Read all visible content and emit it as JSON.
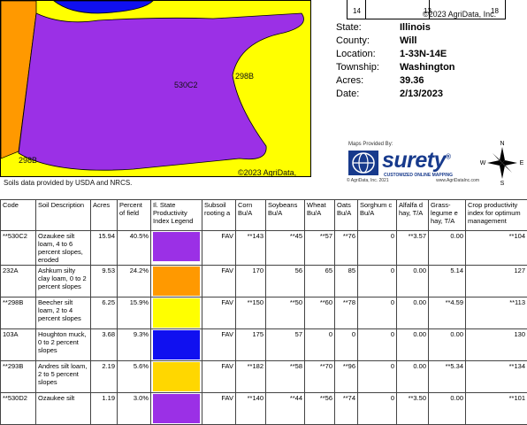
{
  "map": {
    "unit_labels": [
      "530C2",
      "298B",
      "298B"
    ],
    "copyright": "©2023 AgriData, Inc.",
    "source_note": "Soils data provided by USDA and NRCS."
  },
  "section_grid": {
    "numbers": [
      "14",
      "13",
      "18"
    ],
    "copyright": "©2023 AgriData, Inc."
  },
  "info": {
    "rows": [
      {
        "label": "State:",
        "value": "Illinois"
      },
      {
        "label": "County:",
        "value": "Will"
      },
      {
        "label": "Location:",
        "value": "1-33N-14E"
      },
      {
        "label": "Township:",
        "value": "Washington"
      },
      {
        "label": "Acres:",
        "value": "39.36"
      },
      {
        "label": "Date:",
        "value": "2/13/2023"
      }
    ]
  },
  "logo": {
    "maps_provided_by": "Maps Provided By:",
    "word": "surety",
    "registered": "®",
    "tagline": "CUSTOMIZED ONLINE MAPPING",
    "footer_left": "© AgriData, Inc. 2021",
    "footer_right": "www.AgriDataInc.com"
  },
  "compass": {
    "n": "N",
    "s": "S",
    "e": "E",
    "w": "W"
  },
  "colors": {
    "purple": "#9b30e6",
    "orange": "#ff9900",
    "yellow": "#ffff00",
    "blue": "#1010f0",
    "gold": "#ffd700",
    "surety_blue": "#173a8c"
  },
  "table": {
    "headers": [
      "Code",
      "Soil Description",
      "Acres",
      "Percent of field",
      "Il. State Productivity Index Legend",
      "Subsoil rooting a",
      "Corn Bu/A",
      "Soybeans Bu/A",
      "Wheat Bu/A",
      "Oats Bu/A",
      "Sorghum c Bu/A",
      "Alfalfa d hay, T/A",
      "Grass-legume e hay, T/A",
      "Crop productivity index for optimum management"
    ],
    "rows": [
      {
        "code": "**530C2",
        "desc": "Ozaukee silt loam, 4 to 6 percent slopes, eroded",
        "acres": "15.94",
        "pct": "40.5%",
        "color": "#9b30e6",
        "subsoil": "FAV",
        "corn": "**143",
        "soy": "**45",
        "wheat": "**57",
        "oats": "**76",
        "sorghum": "0",
        "alfalfa": "**3.57",
        "grass": "0.00",
        "cpi": "**104"
      },
      {
        "code": "232A",
        "desc": "Ashkum silty clay loam, 0 to 2 percent slopes",
        "acres": "9.53",
        "pct": "24.2%",
        "color": "#ff9900",
        "subsoil": "FAV",
        "corn": "170",
        "soy": "56",
        "wheat": "65",
        "oats": "85",
        "sorghum": "0",
        "alfalfa": "0.00",
        "grass": "5.14",
        "cpi": "127"
      },
      {
        "code": "**298B",
        "desc": "Beecher silt loam, 2 to 4 percent slopes",
        "acres": "6.25",
        "pct": "15.9%",
        "color": "#ffff00",
        "subsoil": "FAV",
        "corn": "**150",
        "soy": "**50",
        "wheat": "**60",
        "oats": "**78",
        "sorghum": "0",
        "alfalfa": "0.00",
        "grass": "**4.59",
        "cpi": "**113"
      },
      {
        "code": "103A",
        "desc": "Houghton muck, 0 to 2 percent slopes",
        "acres": "3.68",
        "pct": "9.3%",
        "color": "#1010f0",
        "subsoil": "FAV",
        "corn": "175",
        "soy": "57",
        "wheat": "0",
        "oats": "0",
        "sorghum": "0",
        "alfalfa": "0.00",
        "grass": "0.00",
        "cpi": "130"
      },
      {
        "code": "**293B",
        "desc": "Andres silt loam, 2 to 5 percent slopes",
        "acres": "2.19",
        "pct": "5.6%",
        "color": "#ffd700",
        "subsoil": "FAV",
        "corn": "**182",
        "soy": "**58",
        "wheat": "**70",
        "oats": "**96",
        "sorghum": "0",
        "alfalfa": "0.00",
        "grass": "**5.34",
        "cpi": "**134"
      },
      {
        "code": "**530D2",
        "desc": "Ozaukee silt",
        "acres": "1.19",
        "pct": "3.0%",
        "color": "#9b30e6",
        "subsoil": "FAV",
        "corn": "**140",
        "soy": "**44",
        "wheat": "**56",
        "oats": "**74",
        "sorghum": "0",
        "alfalfa": "**3.50",
        "grass": "0.00",
        "cpi": "**101"
      }
    ]
  }
}
